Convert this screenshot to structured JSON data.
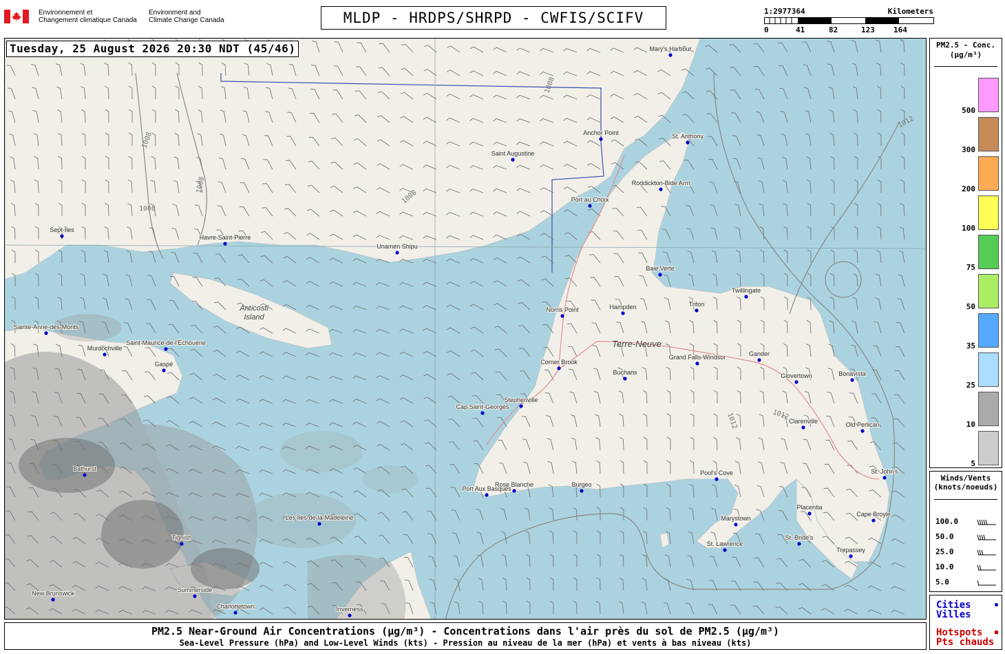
{
  "header": {
    "gov_fr": [
      "Environnement et",
      "Changement climatique Canada"
    ],
    "gov_en": [
      "Environment and",
      "Climate Change Canada"
    ],
    "title": "MLDP - HRDPS/SHRPD - CWFIS/SCIFV",
    "scale_ratio": "1:2977364",
    "scale_unit": "Kilometers",
    "scale_ticks": [
      "0",
      "41",
      "82",
      "123",
      "164"
    ]
  },
  "map": {
    "datetime": "Tuesday, 25 August 2026 20:30 NDT (45/46)",
    "region_labels": [
      "Anticosti Island",
      "Terre-Neuve"
    ],
    "isobar_labels": [
      "1008",
      "1012"
    ],
    "cities": [
      "Mary's Harbour",
      "St. Anthony",
      "Anchor Point",
      "Saint Augustine",
      "Roddickton-Bide Arm",
      "Port au Choix",
      "Sept-Îles",
      "Havre-Saint-Pierre",
      "Unamen Shipu",
      "Baie Verte",
      "Twillingate",
      "Norris Point",
      "Hampden",
      "Triton",
      "Sainte-Anne-des-Monts",
      "Saint-Maurice-de-l'Échouerie",
      "Murdochville",
      "Gaspé",
      "Corner Brook",
      "Grand Falls-Windsor",
      "Gander",
      "Glovertown",
      "Bonavista",
      "Buchans",
      "Stephenville",
      "Cap Saint-Georges",
      "Clarenville",
      "Old Perlican",
      "St. John's",
      "Pool's Cove",
      "Port Aux Basques",
      "Rose Blanche",
      "Burgeo",
      "Bathurst",
      "Les Îles-de-la-Madeleine",
      "Placentia",
      "Marystown",
      "Cape Broyle",
      "St. Lawrence",
      "St. Bride's",
      "Trepassey",
      "Tignish",
      "Summerside",
      "Charlottetown",
      "Inverness",
      "New Brunswick"
    ]
  },
  "caption": {
    "line1": "PM2.5 Near-Ground Air Concentrations (µg/m³) - Concentrations dans l'air près du sol de PM2.5 (µg/m³)",
    "line2": "Sea-Level Pressure (hPa) and Low-Level Winds (kts) - Pression au niveau de la mer (hPa) et vents à bas niveau (kts)"
  },
  "pm_legend": {
    "title": [
      "PM2.5 - Conc.",
      "(µg/m³)"
    ],
    "levels": [
      {
        "label": "500",
        "color": "#ff99ff"
      },
      {
        "label": "300",
        "color": "#c68a57"
      },
      {
        "label": "200",
        "color": "#ffaa55"
      },
      {
        "label": "100",
        "color": "#ffff55"
      },
      {
        "label": "75",
        "color": "#55cc55"
      },
      {
        "label": "50",
        "color": "#aaee66"
      },
      {
        "label": "35",
        "color": "#55aaff"
      },
      {
        "label": "25",
        "color": "#aaddff"
      },
      {
        "label": "10",
        "color": "#aaaaaa"
      },
      {
        "label": "5",
        "color": "#cccccc"
      }
    ]
  },
  "wind_legend": {
    "title": [
      "Winds/Vents",
      "(knots/noeuds)"
    ],
    "speeds": [
      "100.0",
      "50.0",
      "25.0",
      "10.0",
      "5.0"
    ]
  },
  "markers": {
    "cities_en": "Cities",
    "cities_fr": "Villes",
    "hotspots_en": "Hotspots",
    "hotspots_fr": "Pts chauds",
    "city_color": "#0000cc",
    "hotspot_color": "#cc0000"
  }
}
